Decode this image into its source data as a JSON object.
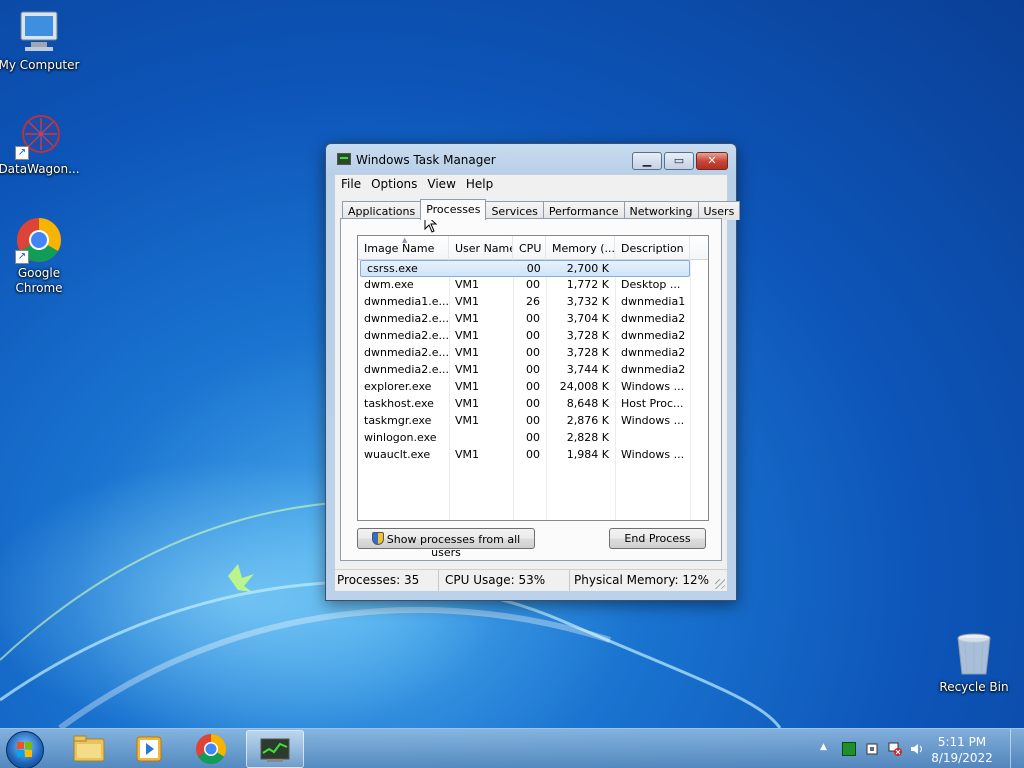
{
  "desktop": {
    "icons": [
      {
        "label": "My Computer",
        "icon": "computer-icon"
      },
      {
        "label": "DataWagon...",
        "icon": "datawagon-icon"
      },
      {
        "label": "Google Chrome",
        "icon": "chrome-icon"
      },
      {
        "label": "Recycle Bin",
        "icon": "recycle-bin-icon"
      }
    ]
  },
  "window": {
    "title": "Windows Task Manager",
    "menu": [
      "File",
      "Options",
      "View",
      "Help"
    ],
    "tabs": [
      "Applications",
      "Processes",
      "Services",
      "Performance",
      "Networking",
      "Users"
    ],
    "active_tab": "Processes",
    "columns": [
      "Image Name",
      "User Name",
      "CPU",
      "Memory (...",
      "Description"
    ],
    "processes": [
      {
        "name": "csrss.exe",
        "user": "",
        "cpu": "00",
        "memory": "2,700 K",
        "description": ""
      },
      {
        "name": "dwm.exe",
        "user": "VM1",
        "cpu": "00",
        "memory": "1,772 K",
        "description": "Desktop ..."
      },
      {
        "name": "dwnmedia1.e...",
        "user": "VM1",
        "cpu": "26",
        "memory": "3,732 K",
        "description": "dwnmedia1"
      },
      {
        "name": "dwnmedia2.e...",
        "user": "VM1",
        "cpu": "00",
        "memory": "3,704 K",
        "description": "dwnmedia2"
      },
      {
        "name": "dwnmedia2.e...",
        "user": "VM1",
        "cpu": "00",
        "memory": "3,728 K",
        "description": "dwnmedia2"
      },
      {
        "name": "dwnmedia2.e...",
        "user": "VM1",
        "cpu": "00",
        "memory": "3,728 K",
        "description": "dwnmedia2"
      },
      {
        "name": "dwnmedia2.e...",
        "user": "VM1",
        "cpu": "00",
        "memory": "3,744 K",
        "description": "dwnmedia2"
      },
      {
        "name": "explorer.exe",
        "user": "VM1",
        "cpu": "00",
        "memory": "24,008 K",
        "description": "Windows ..."
      },
      {
        "name": "taskhost.exe",
        "user": "VM1",
        "cpu": "00",
        "memory": "8,648 K",
        "description": "Host Proc..."
      },
      {
        "name": "taskmgr.exe",
        "user": "VM1",
        "cpu": "00",
        "memory": "2,876 K",
        "description": "Windows ..."
      },
      {
        "name": "winlogon.exe",
        "user": "",
        "cpu": "00",
        "memory": "2,828 K",
        "description": ""
      },
      {
        "name": "wuauclt.exe",
        "user": "VM1",
        "cpu": "00",
        "memory": "1,984 K",
        "description": "Windows ..."
      }
    ],
    "selected_process": "csrss.exe",
    "show_all_button": "Show processes from all users",
    "end_process_button": "End Process",
    "status": {
      "processes": "Processes: 35",
      "cpu": "CPU Usage: 53%",
      "memory": "Physical Memory: 12%"
    }
  },
  "taskbar": {
    "pinned": [
      "explorer-icon",
      "media-player-icon",
      "chrome-icon",
      "task-manager-icon"
    ],
    "active": "task-manager-icon",
    "clock_time": "5:11 PM",
    "clock_date": "8/19/2022"
  },
  "colors": {
    "desktop_blue": "#1a74d0",
    "selection": "#cfe4fa",
    "taskbar": "#6a9cc8"
  }
}
